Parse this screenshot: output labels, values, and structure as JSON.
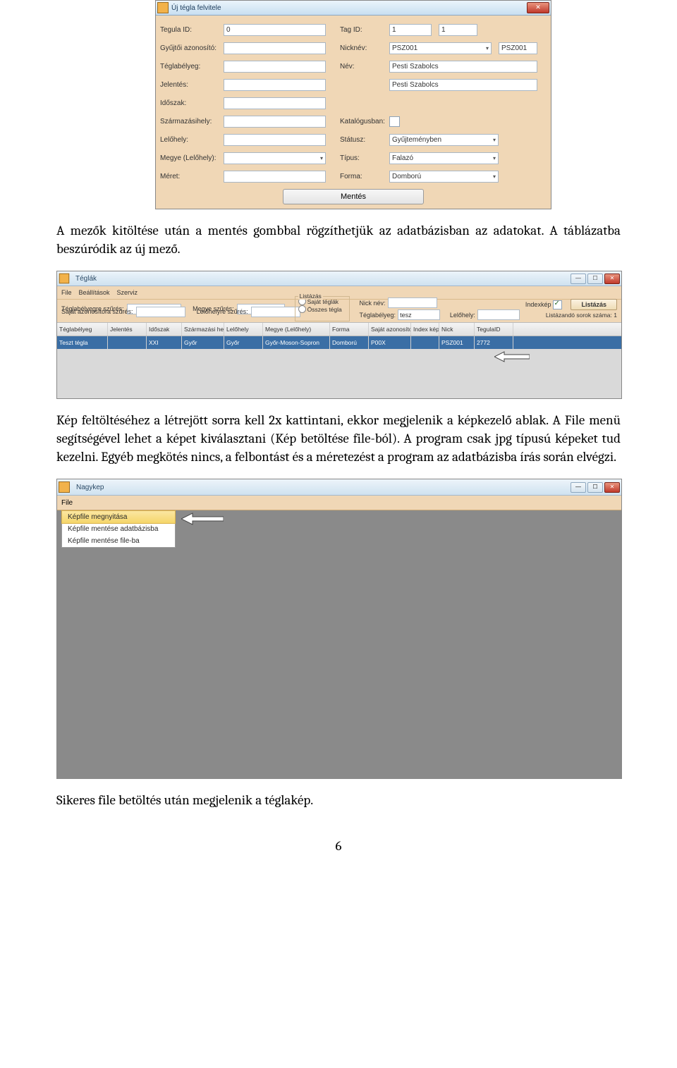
{
  "dialog": {
    "title": "Új tégla felvitele",
    "labels": {
      "tegula_id": "Tegula ID:",
      "gyujtoi": "Gyűjtői azonosító:",
      "teglabelyeg": "Téglabélyeg:",
      "jelentes": "Jelentés:",
      "idoszak": "Időszak:",
      "szarmazas": "Származásihely:",
      "lelohely": "Lelőhely:",
      "megye": "Megye (Lelőhely):",
      "meret": "Méret:",
      "tag_id": "Tag ID:",
      "nicknev": "Nicknév:",
      "nev": "Név:",
      "katalogus": "Katalógusban:",
      "statusz": "Státusz:",
      "tipus": "Típus:",
      "forma": "Forma:"
    },
    "values": {
      "tegula_id": "0",
      "tag_id_a": "1",
      "tag_id_b": "1",
      "nick_combo": "PSZ001",
      "nick_text": "PSZ001",
      "nev": "Pesti Szabolcs",
      "nev2": "Pesti Szabolcs",
      "statusz": "Gyűjteményben",
      "tipus": "Falazó",
      "forma": "Domború"
    },
    "save": "Mentés"
  },
  "para1": "A mezők kitöltése után a mentés gombbal rögzíthetjük az adatbázisban az adatokat. A táblázatba beszúródik az új mező.",
  "listwin": {
    "title": "Téglák",
    "menu": {
      "file": "File",
      "beall": "Beállítások",
      "szerviz": "Szerviz"
    },
    "filters": {
      "teglabelyegre": "Téglabélyegre szűrés:",
      "sajatazon": "Saját azonosítóra szűrés:",
      "megye": "Megye szűrés:",
      "lelohely": "Lelőhelyre szűrés:",
      "listazas_legend": "Listázás",
      "sajat_teglak": "Saját téglák",
      "osszes": "Összes tégla",
      "nicknev": "Nick név:",
      "teglabelyeg": "Téglabélyeg:",
      "teglabelyeg_val": "tesz",
      "lelohely2": "Lelőhely:",
      "indexkep": "Indexkép",
      "listazas_btn": "Listázás",
      "sorok": "Listázandó sorok száma: 1"
    },
    "headers": [
      "Téglabélyeg",
      "Jelentés",
      "Időszak",
      "Származási hely",
      "Lelőhely",
      "Megye (Lelőhely)",
      "Forma",
      "Saját azonosító",
      "Index kép",
      "Nick",
      "TegulaID"
    ],
    "row": [
      "Teszt tégla",
      "",
      "XXI",
      "Győr",
      "Győr",
      "Győr-Moson-Sopron",
      "Domború",
      "P00X",
      "",
      "PSZ001",
      "2772"
    ]
  },
  "para2": "Kép feltöltéséhez a létrejött sorra kell 2x kattintani, ekkor megjelenik a képkezelő ablak. A File menü segítségével lehet a képet kiválasztani (Kép betöltése file-ból). A program csak jpg típusú képeket tud kezelni. Egyéb megkötés nincs, a felbontást és a méretezést a program az adatbázisba írás során elvégzi.",
  "nk": {
    "title": "Nagykep",
    "file": "File",
    "items": [
      "Képfile megnyitása",
      "Képfile mentése adatbázisba",
      "Képfile mentése file-ba"
    ]
  },
  "para3": "Sikeres file betöltés után megjelenik a téglakép.",
  "pagenum": "6"
}
